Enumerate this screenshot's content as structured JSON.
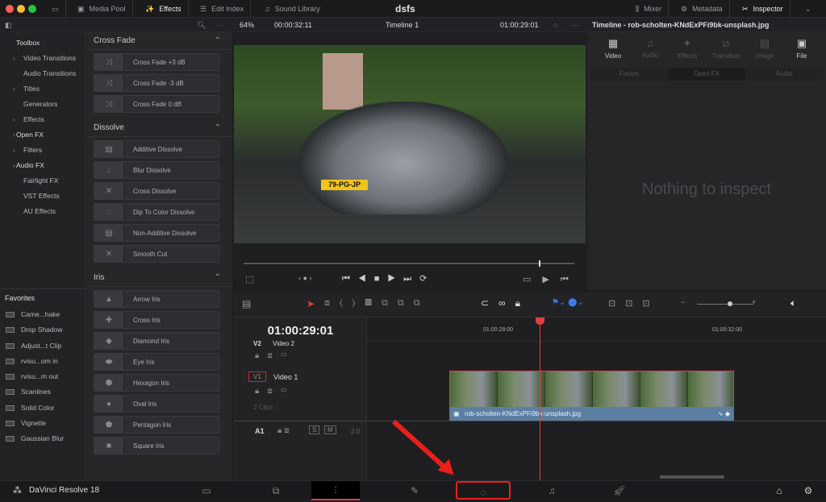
{
  "window": {
    "title": "dsfs"
  },
  "topbar": {
    "media_pool": "Media Pool",
    "effects": "Effects",
    "edit_index": "Edit Index",
    "sound_library": "Sound Library",
    "mixer": "Mixer",
    "metadata": "Metadata",
    "inspector": "Inspector"
  },
  "subbar": {
    "zoom": "64%",
    "duration": "00:00:32:11",
    "timeline": "Timeline 1",
    "timecode": "01:00:29:01",
    "inspector_title": "Timeline - rob-scholten-KNdExPFi9bk-unsplash.jpg"
  },
  "toolbox": {
    "items": [
      "Toolbox",
      "Video Transitions",
      "Audio Transitions",
      "Titles",
      "Generators",
      "Effects",
      "Open FX",
      "Filters",
      "Audio FX",
      "Fairlight FX",
      "VST Effects",
      "AU Effects"
    ]
  },
  "favorites": {
    "title": "Favorites",
    "items": [
      "Came...hake",
      "Drop Shadow",
      "Adjust...t Clip",
      "rvisu...om in",
      "rvisu...m out",
      "Scanlines",
      "Solid Color",
      "Vignette",
      "Gaussian Blur"
    ]
  },
  "effects": {
    "cross_fade": {
      "title": "Cross Fade",
      "items": [
        "Cross Fade +3 dB",
        "Cross Fade -3 dB",
        "Cross Fade 0 dB"
      ]
    },
    "dissolve": {
      "title": "Dissolve",
      "items": [
        "Additive Dissolve",
        "Blur Dissolve",
        "Cross Dissolve",
        "Dip To Color Dissolve",
        "Non-Additive Dissolve",
        "Smooth Cut"
      ]
    },
    "iris": {
      "title": "Iris",
      "items": [
        "Arrow Iris",
        "Cross Iris",
        "Diamond Iris",
        "Eye Iris",
        "Hexagon Iris",
        "Oval Iris",
        "Pentagon Iris",
        "Square Iris"
      ]
    }
  },
  "viewer": {
    "plate": "79-PG-JP"
  },
  "inspector": {
    "tabs": [
      "Video",
      "Audio",
      "Effects",
      "Transition",
      "Image",
      "File"
    ],
    "subtabs": [
      "Fusion",
      "Open FX",
      "Audio"
    ],
    "empty": "Nothing to inspect"
  },
  "timeline": {
    "timecode": "01:00:29:01",
    "ruler": [
      "01:00:28:00",
      "01:00:32:00"
    ],
    "v2": {
      "id": "V2",
      "name": "Video 2"
    },
    "v1": {
      "id": "V1",
      "name": "Video 1",
      "clips": "2 Clips"
    },
    "a1": {
      "id": "A1",
      "s": "S",
      "m": "M",
      "level": "2.0"
    },
    "clip_name": "rob-scholten-KNdExPFi9bk-unsplash.jpg"
  },
  "bottom": {
    "app": "DaVinci Resolve 18"
  },
  "colors": {
    "accent": "#e04040",
    "clip": "#5a7fa0"
  }
}
